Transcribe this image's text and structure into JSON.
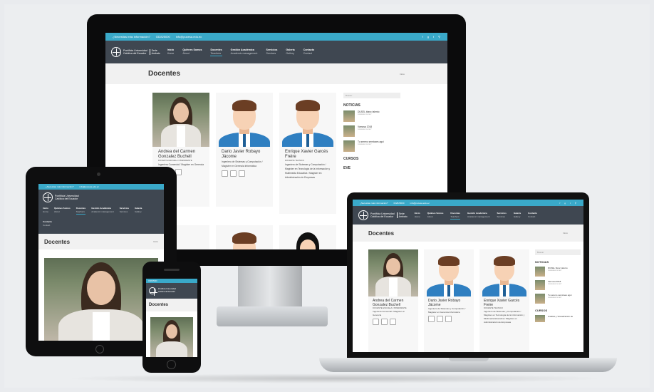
{
  "site": {
    "topbar": {
      "info": "¿Necesitas más información?",
      "phone": "032825000",
      "email": "info@pucesa.edu.ec",
      "social_icons": [
        "facebook-icon",
        "google-plus-icon",
        "twitter-icon",
        "search-icon"
      ]
    },
    "brand": {
      "line1": "Pontificia Universidad",
      "line2": "Católica del Ecuador",
      "sede": "Sede",
      "campus": "Ambato"
    },
    "menu": [
      {
        "label": "Inicio",
        "sub": "Home"
      },
      {
        "label": "Quiénes Somos",
        "sub": "About"
      },
      {
        "label": "Docentes",
        "sub": "Teachers"
      },
      {
        "label": "Gestión Académica",
        "sub": "Academic management"
      },
      {
        "label": "Servicios",
        "sub": "Services"
      },
      {
        "label": "Galería",
        "sub": "Gallery"
      },
      {
        "label": "Contacto",
        "sub": "Contact"
      }
    ],
    "active_menu": "Docentes",
    "page_title": "Docentes",
    "breadcrumb": "Inicio",
    "teachers": [
      {
        "name": "Andrea del Carmen Gonzalez Buchell",
        "role": "DOCENTE ESCUELA / PRESIDENTE",
        "desc": "Ingeniera Comercial / Magíster en Gerencia"
      },
      {
        "name": "Dario Javier Robayo Jácome",
        "role": "",
        "desc": "Ingeniero de Sistemas y Computación / Magíster en Gerencia Informática"
      },
      {
        "name": "Enrique Xavier Garcés Freire",
        "role": "DOCENTE TECNICO",
        "desc": "Ingeniero de Sistemas y Computación / Magíster en Tecnología de la Información y Multimedia Educativa / Magíster en Administración de Empresas"
      }
    ],
    "sidebar": {
      "search_placeholder": "Buscar",
      "news_title": "NOTICIAS",
      "news": [
        {
          "title": "DUSEL blanc talento",
          "date": "2018/06/06 15:2017"
        },
        {
          "title": "Vamosa 2018",
          "date": "2018/06/06 15:2017"
        },
        {
          "title": "Tu sereno semicaes agui",
          "date": "2018/06/06 15:2017"
        }
      ],
      "cursos_title": "CURSOS",
      "cursos_item": "Análisis y Visualización de",
      "eventos_title": "EVE"
    },
    "colors": {
      "accent": "#3aa9c9",
      "nav": "#3f4751",
      "suit": "#2f7fc1"
    }
  }
}
